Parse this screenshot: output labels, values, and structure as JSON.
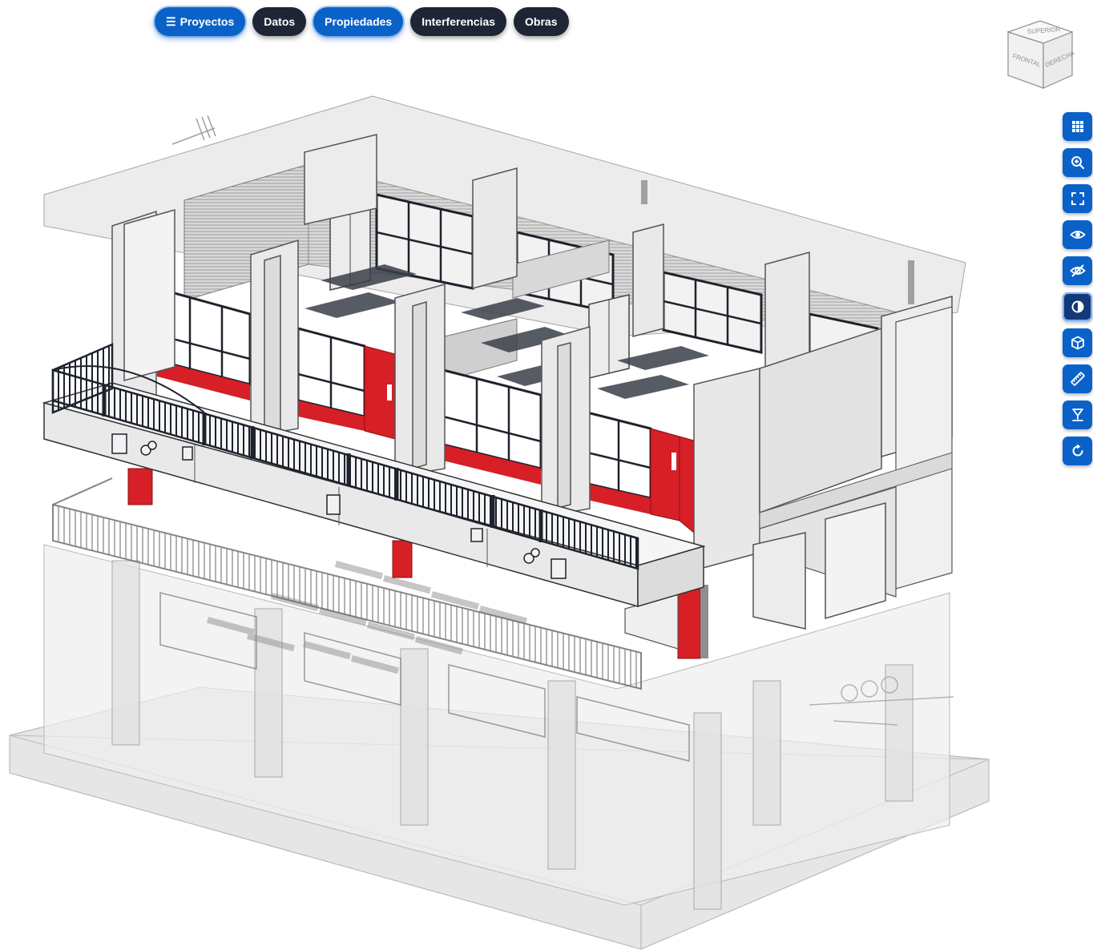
{
  "toolbar_top": {
    "tabs": [
      {
        "label": "Proyectos",
        "icon": "menu-icon",
        "active": true
      },
      {
        "label": "Datos",
        "active": false
      },
      {
        "label": "Propiedades",
        "active": true
      },
      {
        "label": "Interferencias",
        "active": false
      },
      {
        "label": "Obras",
        "active": false
      }
    ],
    "menu_glyph": "☰"
  },
  "viewcube": {
    "top": "SUPERIOR",
    "front": "FRONTAL",
    "right": "DERECHA"
  },
  "side_tools": [
    {
      "icon": "grid-icon",
      "active": false
    },
    {
      "icon": "zoom-in-icon",
      "active": false
    },
    {
      "icon": "fit-view-icon",
      "active": false
    },
    {
      "icon": "eye-icon",
      "active": false
    },
    {
      "icon": "eye-off-icon",
      "active": false
    },
    {
      "icon": "contrast-icon",
      "active": true
    },
    {
      "icon": "cube-icon",
      "active": false
    },
    {
      "icon": "ruler-icon",
      "active": false
    },
    {
      "icon": "section-icon",
      "active": false
    },
    {
      "icon": "reset-icon",
      "active": false
    }
  ],
  "colors": {
    "accent": "#0a62c9",
    "dark": "#1e2535",
    "highlight": "#d61f26"
  }
}
